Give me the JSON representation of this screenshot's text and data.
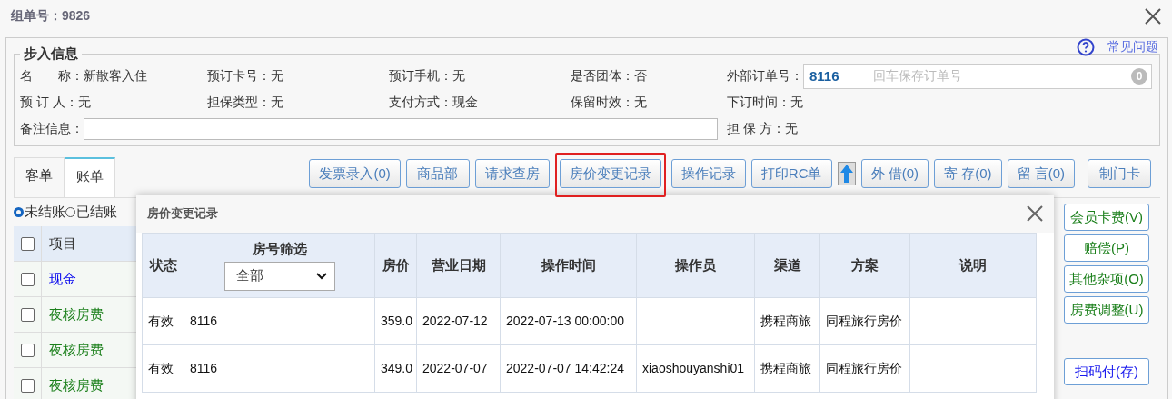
{
  "window": {
    "title": "组单号：9826"
  },
  "info": {
    "legend": "步入信息",
    "help": "常见问题",
    "rows": [
      [
        {
          "kind": "text",
          "label": "名　　称：",
          "value": "新散客入住"
        },
        {
          "kind": "text",
          "label": "预订卡号：",
          "value": "无"
        },
        {
          "kind": "text",
          "label": "预订手机：",
          "value": "无"
        },
        {
          "kind": "text",
          "label": "是否团体：",
          "value": "否"
        },
        {
          "kind": "order",
          "label": "外部订单号：",
          "value": "8116",
          "placeholder": "回车保存订单号",
          "badge": "0"
        }
      ],
      [
        {
          "kind": "text",
          "label": "预 订 人：",
          "value": "无"
        },
        {
          "kind": "text",
          "label": "担保类型：",
          "value": "无"
        },
        {
          "kind": "text",
          "label": "支付方式：",
          "value": "现金"
        },
        {
          "kind": "text",
          "label": "保留时效：",
          "value": "无"
        },
        {
          "kind": "text",
          "label": "下订时间：",
          "value": "无"
        }
      ],
      [
        {
          "kind": "input",
          "label": "备注信息："
        },
        "",
        "",
        "",
        {
          "kind": "text",
          "label": "担 保 方：",
          "value": "无"
        }
      ]
    ]
  },
  "tabs": [
    {
      "label": "客单",
      "selected": false
    },
    {
      "label": "账单",
      "selected": true
    }
  ],
  "toolbar": [
    {
      "kind": "button",
      "label": "发票录入(0)",
      "highlighted": false
    },
    {
      "kind": "button",
      "label": "商品部",
      "highlighted": false
    },
    {
      "kind": "button",
      "label": "请求查房",
      "highlighted": false
    },
    {
      "kind": "button",
      "label": "房价变更记录",
      "highlighted": true
    },
    {
      "kind": "button",
      "label": "操作记录",
      "highlighted": false
    },
    {
      "kind": "button",
      "label": "打印RC单",
      "highlighted": false
    },
    {
      "kind": "arrow"
    },
    {
      "kind": "button",
      "label": "外 借(0)",
      "highlighted": false
    },
    {
      "kind": "button",
      "label": "寄 存(0)",
      "highlighted": false
    },
    {
      "kind": "button",
      "label": "留 言(0)",
      "highlighted": false
    },
    {
      "kind": "button",
      "label": "制门卡",
      "highlighted": false
    }
  ],
  "filters": [
    {
      "label": "未结账",
      "selected": true
    },
    {
      "label": "已结账",
      "selected": false
    }
  ],
  "bill": {
    "header": "项目",
    "header_checked": false,
    "rows": [
      {
        "label": "现金",
        "color": "#0000ee",
        "checked": false
      },
      {
        "label": "夜核房费",
        "color": "#1a7f1a",
        "checked": false
      },
      {
        "label": "夜核房费",
        "color": "#1a7f1a",
        "checked": false
      },
      {
        "label": "夜核房费",
        "color": "#1a7f1a",
        "checked": false
      }
    ]
  },
  "side_buttons": [
    {
      "label": "会员卡费(V)",
      "color": "#1a7f1a"
    },
    {
      "label": "赔偿(P)",
      "color": "#1a7f1a"
    },
    {
      "label": "其他杂项(O)",
      "color": "#1a7f1a"
    },
    {
      "label": "房费调整(U)",
      "color": "#1a7f1a"
    },
    {
      "label": "扫码付(存)",
      "color": "#1a1aee"
    }
  ],
  "dialog": {
    "title": "房价变更记录",
    "filter": {
      "value": "全部"
    },
    "columns": [
      "状态",
      "房号筛选",
      "房价",
      "营业日期",
      "操作时间",
      "操作员",
      "渠道",
      "方案",
      "说明"
    ],
    "rows": [
      [
        "有效",
        "8116",
        "359.0",
        "2022-07-12",
        "2022-07-13 00:00:00",
        "",
        "携程商旅",
        "同程旅行房价",
        ""
      ],
      [
        "有效",
        "8116",
        "349.0",
        "2022-07-07",
        "2022-07-07 14:42:24",
        "xiaoshouyanshi01",
        "携程商旅",
        "同程旅行房价",
        ""
      ]
    ]
  }
}
